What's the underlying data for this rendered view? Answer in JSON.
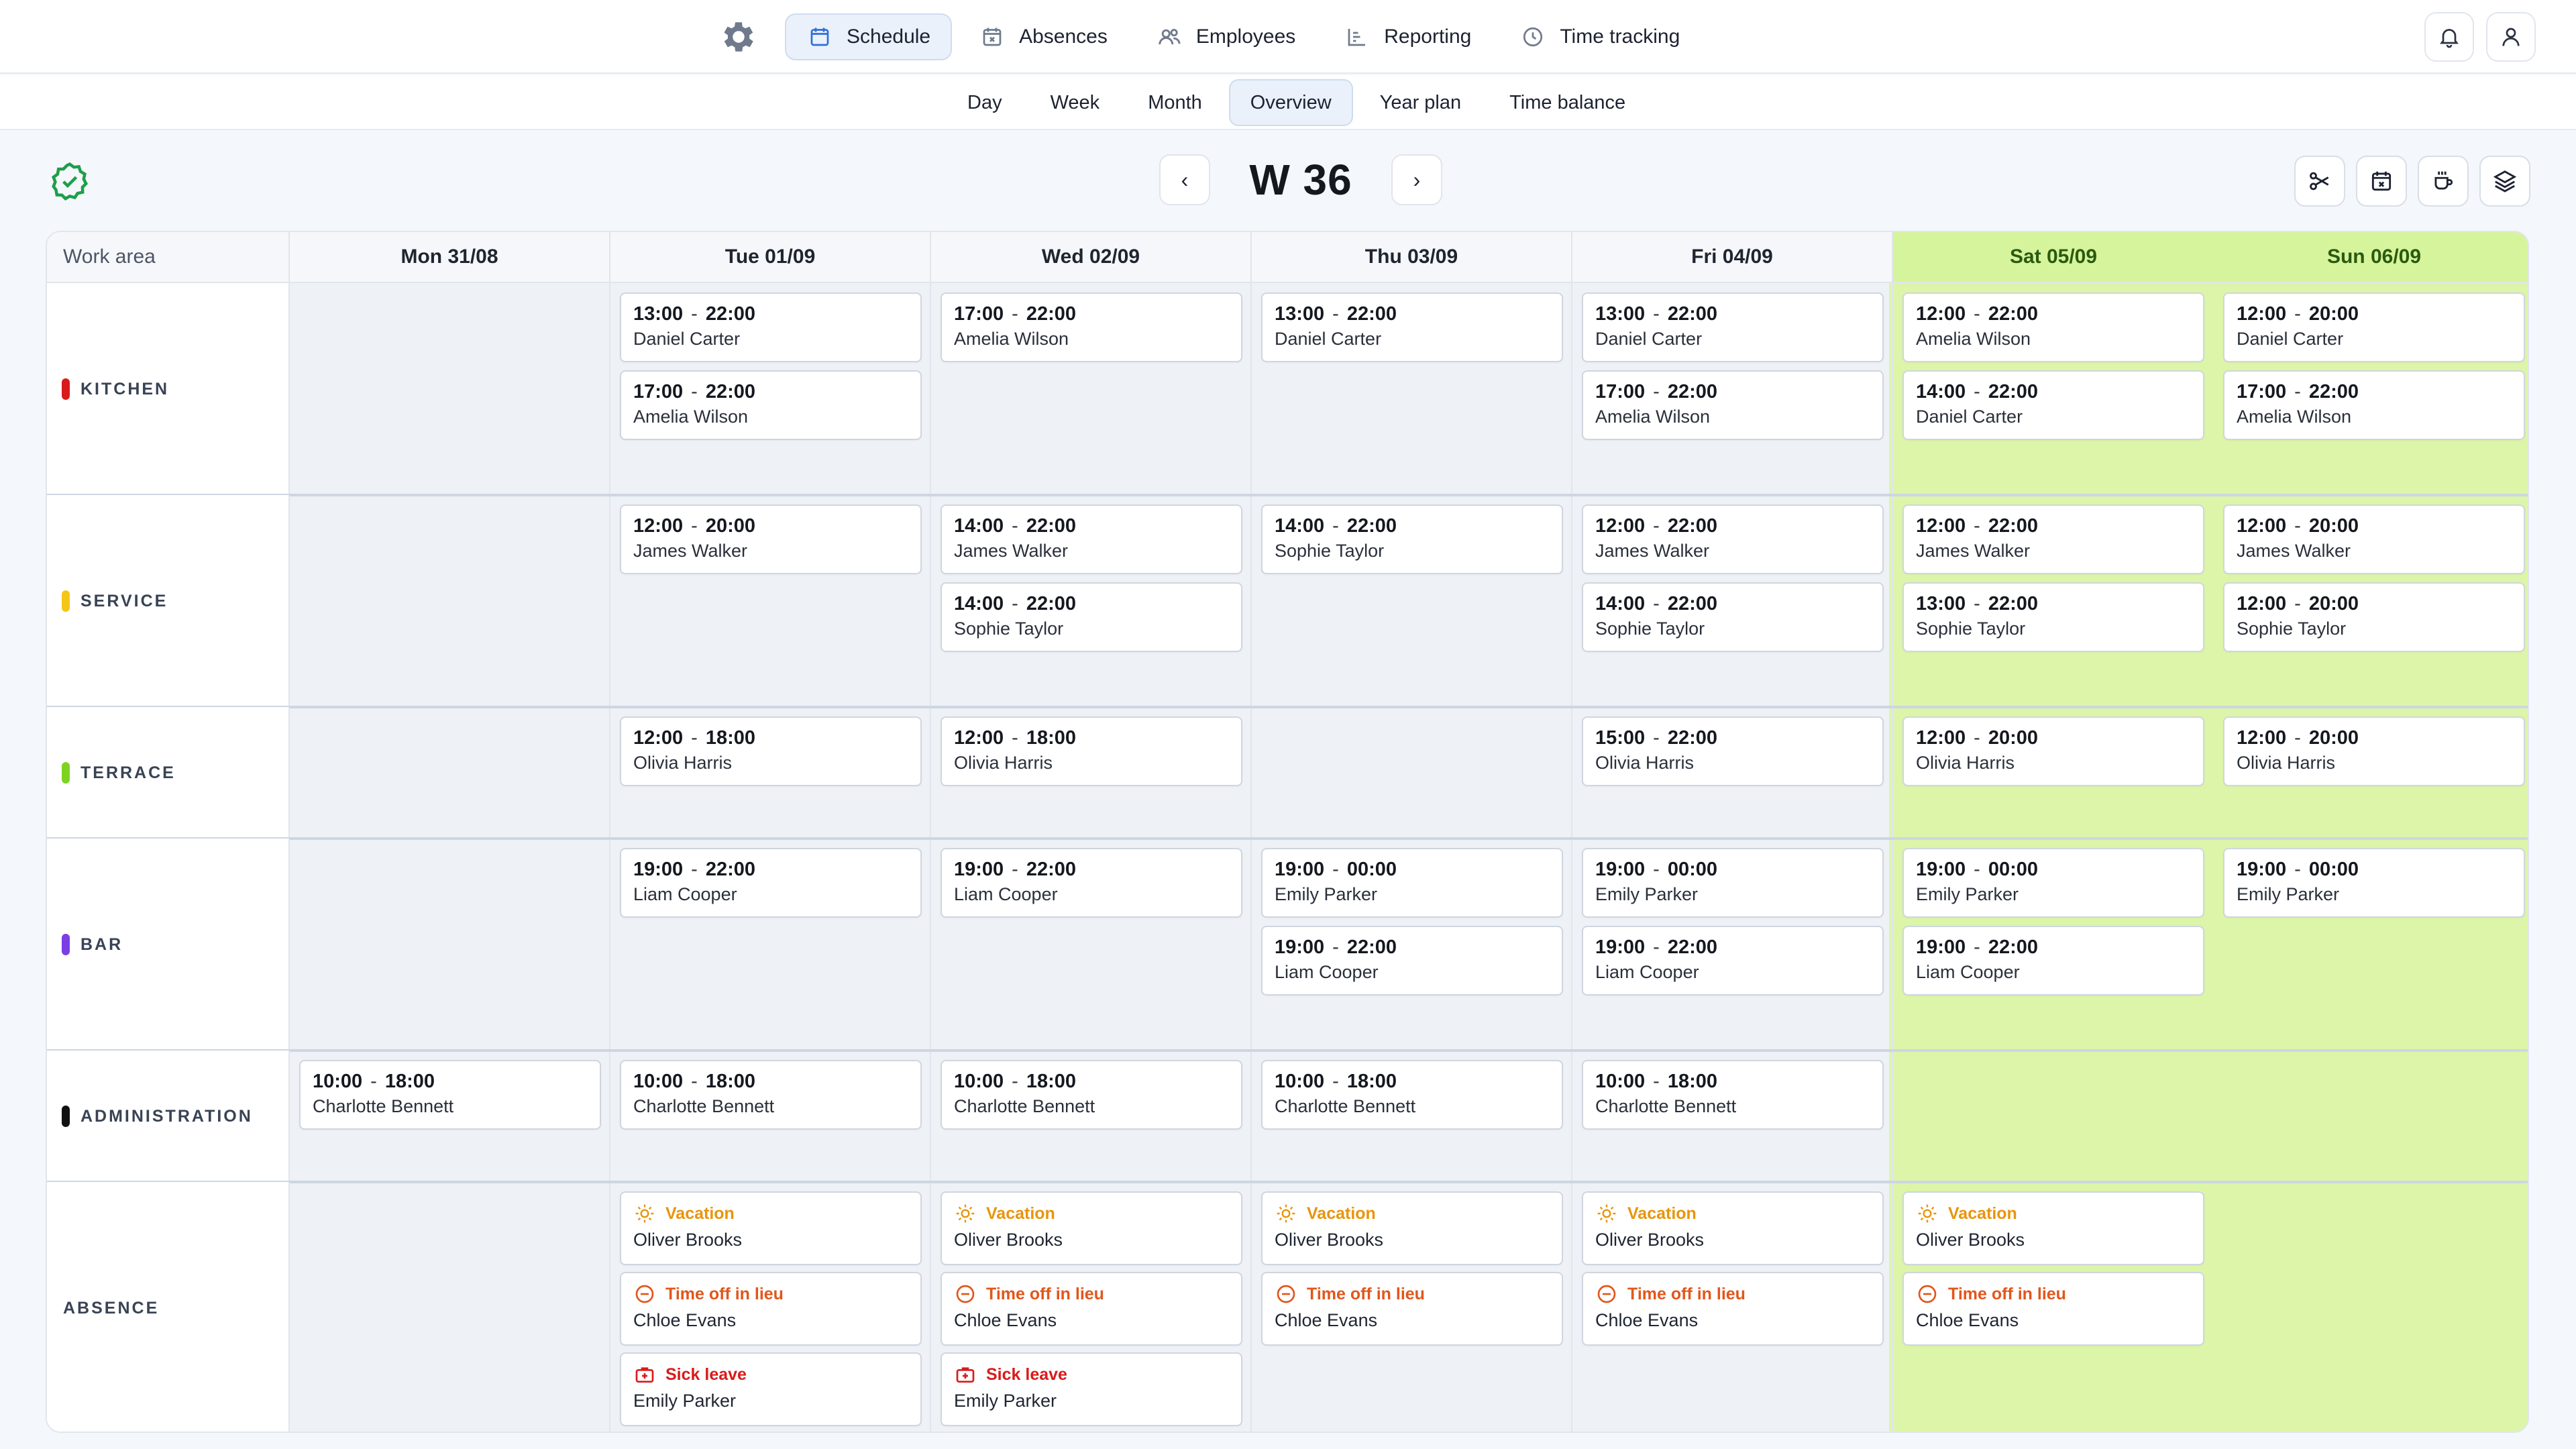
{
  "nav": {
    "tabs": [
      {
        "label": "Schedule",
        "icon": "calendar-icon",
        "active": true
      },
      {
        "label": "Absences",
        "icon": "calendar-x-icon",
        "active": false
      },
      {
        "label": "Employees",
        "icon": "users-icon",
        "active": false
      },
      {
        "label": "Reporting",
        "icon": "chart-icon",
        "active": false
      },
      {
        "label": "Time tracking",
        "icon": "clock-icon",
        "active": false
      }
    ]
  },
  "views": [
    "Day",
    "Week",
    "Month",
    "Overview",
    "Year plan",
    "Time balance"
  ],
  "active_view": "Overview",
  "week": {
    "title": "W 36",
    "prev": "‹",
    "next": "›"
  },
  "grid": {
    "corner_label": "Work area",
    "days": [
      "Mon 31/08",
      "Tue 01/09",
      "Wed 02/09",
      "Thu 03/09",
      "Fri 04/09",
      "Sat 05/09",
      "Sun 06/09"
    ],
    "areas": [
      {
        "label": "KITCHEN",
        "color": "#d81b1b",
        "shifts": [
          [],
          [
            [
              "13:00",
              "22:00",
              "Daniel Carter"
            ],
            [
              "17:00",
              "22:00",
              "Amelia Wilson"
            ]
          ],
          [
            [
              "17:00",
              "22:00",
              "Amelia Wilson"
            ]
          ],
          [
            [
              "13:00",
              "22:00",
              "Daniel Carter"
            ]
          ],
          [
            [
              "13:00",
              "22:00",
              "Daniel Carter"
            ],
            [
              "17:00",
              "22:00",
              "Amelia Wilson"
            ]
          ],
          [
            [
              "12:00",
              "22:00",
              "Amelia Wilson"
            ],
            [
              "14:00",
              "22:00",
              "Daniel Carter"
            ]
          ],
          [
            [
              "12:00",
              "20:00",
              "Daniel Carter"
            ],
            [
              "17:00",
              "22:00",
              "Amelia Wilson"
            ]
          ]
        ]
      },
      {
        "label": "SERVICE",
        "color": "#f5c518",
        "shifts": [
          [],
          [
            [
              "12:00",
              "20:00",
              "James Walker"
            ]
          ],
          [
            [
              "14:00",
              "22:00",
              "James Walker"
            ],
            [
              "14:00",
              "22:00",
              "Sophie Taylor"
            ]
          ],
          [
            [
              "14:00",
              "22:00",
              "Sophie Taylor"
            ]
          ],
          [
            [
              "12:00",
              "22:00",
              "James Walker"
            ],
            [
              "14:00",
              "22:00",
              "Sophie Taylor"
            ]
          ],
          [
            [
              "12:00",
              "22:00",
              "James Walker"
            ],
            [
              "13:00",
              "22:00",
              "Sophie Taylor"
            ]
          ],
          [
            [
              "12:00",
              "20:00",
              "James Walker"
            ],
            [
              "12:00",
              "20:00",
              "Sophie Taylor"
            ]
          ]
        ]
      },
      {
        "label": "TERRACE",
        "color": "#7ed321",
        "shifts": [
          [],
          [
            [
              "12:00",
              "18:00",
              "Olivia Harris"
            ]
          ],
          [
            [
              "12:00",
              "18:00",
              "Olivia Harris"
            ]
          ],
          [],
          [
            [
              "15:00",
              "22:00",
              "Olivia Harris"
            ]
          ],
          [
            [
              "12:00",
              "20:00",
              "Olivia Harris"
            ]
          ],
          [
            [
              "12:00",
              "20:00",
              "Olivia Harris"
            ]
          ]
        ]
      },
      {
        "label": "BAR",
        "color": "#7b3fe4",
        "shifts": [
          [],
          [
            [
              "19:00",
              "22:00",
              "Liam Cooper"
            ]
          ],
          [
            [
              "19:00",
              "22:00",
              "Liam Cooper"
            ]
          ],
          [
            [
              "19:00",
              "00:00",
              "Emily Parker"
            ],
            [
              "19:00",
              "22:00",
              "Liam Cooper"
            ]
          ],
          [
            [
              "19:00",
              "00:00",
              "Emily Parker"
            ],
            [
              "19:00",
              "22:00",
              "Liam Cooper"
            ]
          ],
          [
            [
              "19:00",
              "00:00",
              "Emily Parker"
            ],
            [
              "19:00",
              "22:00",
              "Liam Cooper"
            ]
          ],
          [
            [
              "19:00",
              "00:00",
              "Emily Parker"
            ]
          ]
        ]
      },
      {
        "label": "ADMINISTRATION",
        "color": "#111111",
        "shifts": [
          [
            [
              "10:00",
              "18:00",
              "Charlotte Bennett"
            ]
          ],
          [
            [
              "10:00",
              "18:00",
              "Charlotte Bennett"
            ]
          ],
          [
            [
              "10:00",
              "18:00",
              "Charlotte Bennett"
            ]
          ],
          [
            [
              "10:00",
              "18:00",
              "Charlotte Bennett"
            ]
          ],
          [
            [
              "10:00",
              "18:00",
              "Charlotte Bennett"
            ]
          ],
          [],
          []
        ]
      }
    ],
    "absence": {
      "label": "ABSENCE",
      "types": {
        "vacation": {
          "label": "Vacation",
          "color": "#e8950c",
          "icon": "sun-icon"
        },
        "toil": {
          "label": "Time off in lieu",
          "color": "#e2561b",
          "icon": "minus-circle-icon"
        },
        "sick": {
          "label": "Sick leave",
          "color": "#d81b1b",
          "icon": "first-aid-icon"
        }
      },
      "days": [
        [],
        [
          [
            "vacation",
            "Oliver Brooks"
          ],
          [
            "toil",
            "Chloe Evans"
          ],
          [
            "sick",
            "Emily Parker"
          ]
        ],
        [
          [
            "vacation",
            "Oliver Brooks"
          ],
          [
            "toil",
            "Chloe Evans"
          ],
          [
            "sick",
            "Emily Parker"
          ]
        ],
        [
          [
            "vacation",
            "Oliver Brooks"
          ],
          [
            "toil",
            "Chloe Evans"
          ]
        ],
        [
          [
            "vacation",
            "Oliver Brooks"
          ],
          [
            "toil",
            "Chloe Evans"
          ]
        ],
        [
          [
            "vacation",
            "Oliver Brooks"
          ],
          [
            "toil",
            "Chloe Evans"
          ]
        ],
        []
      ]
    }
  }
}
